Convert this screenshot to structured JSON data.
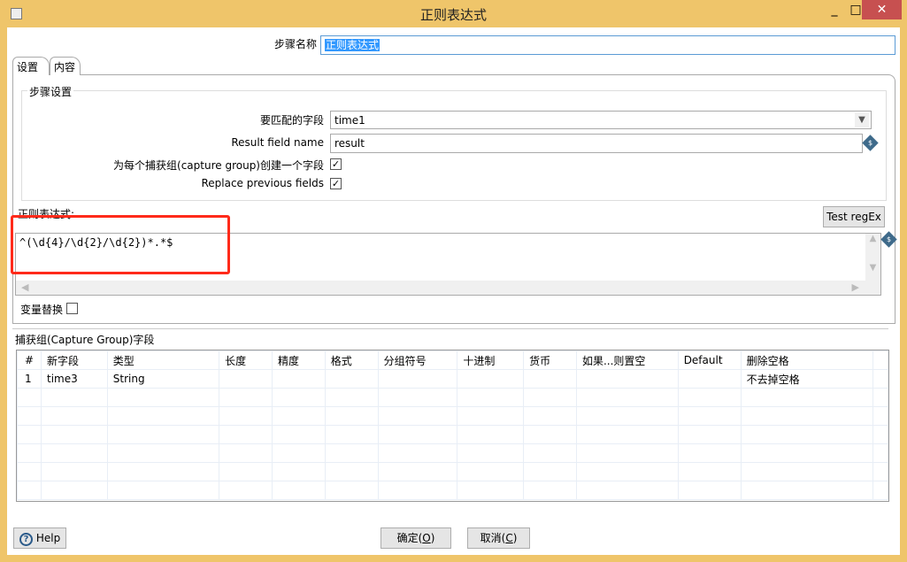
{
  "window": {
    "title": "正则表达式",
    "minimize": "_",
    "maximize": "□",
    "close": "✕"
  },
  "step_name": {
    "label": "步骤名称",
    "value": "正则表达式"
  },
  "tabs": [
    {
      "label": "设置",
      "active": true
    },
    {
      "label": "内容",
      "active": false
    }
  ],
  "step_settings": {
    "title": "步骤设置",
    "match_field_label": "要匹配的字段",
    "match_field_value": "time1",
    "result_field_label": "Result field name",
    "result_field_value": "result",
    "create_fields_label": "为每个捕获组(capture group)创建一个字段",
    "create_fields_checked": true,
    "replace_label": "Replace previous fields",
    "replace_checked": true
  },
  "regex": {
    "label": "正则表达式:",
    "value": "^(\\d{4}/\\d{2}/\\d{2})*.*$",
    "test_button": "Test regEx",
    "highlight_color": "#FF2A1A"
  },
  "variable_substitution": {
    "label": "变量替换",
    "checked": false
  },
  "capture_group": {
    "title": "捕获组(Capture Group)字段",
    "columns": [
      "#",
      "新字段",
      "类型",
      "长度",
      "精度",
      "格式",
      "分组符号",
      "十进制",
      "货币",
      "如果...则置空",
      "Default",
      "删除空格",
      ""
    ],
    "rows": [
      [
        "1",
        "time3",
        "String",
        "",
        "",
        "",
        "",
        "",
        "",
        "",
        "",
        "不去掉空格",
        ""
      ]
    ]
  },
  "buttons": {
    "help": "Help",
    "ok": "确定",
    "ok_key": "O",
    "cancel": "取消",
    "cancel_key": "C"
  },
  "colors": {
    "title_bar": "#EFC56A",
    "close_button": "#C75050",
    "selection": "#3399FF",
    "variable_icon": "#3E6A8A"
  }
}
